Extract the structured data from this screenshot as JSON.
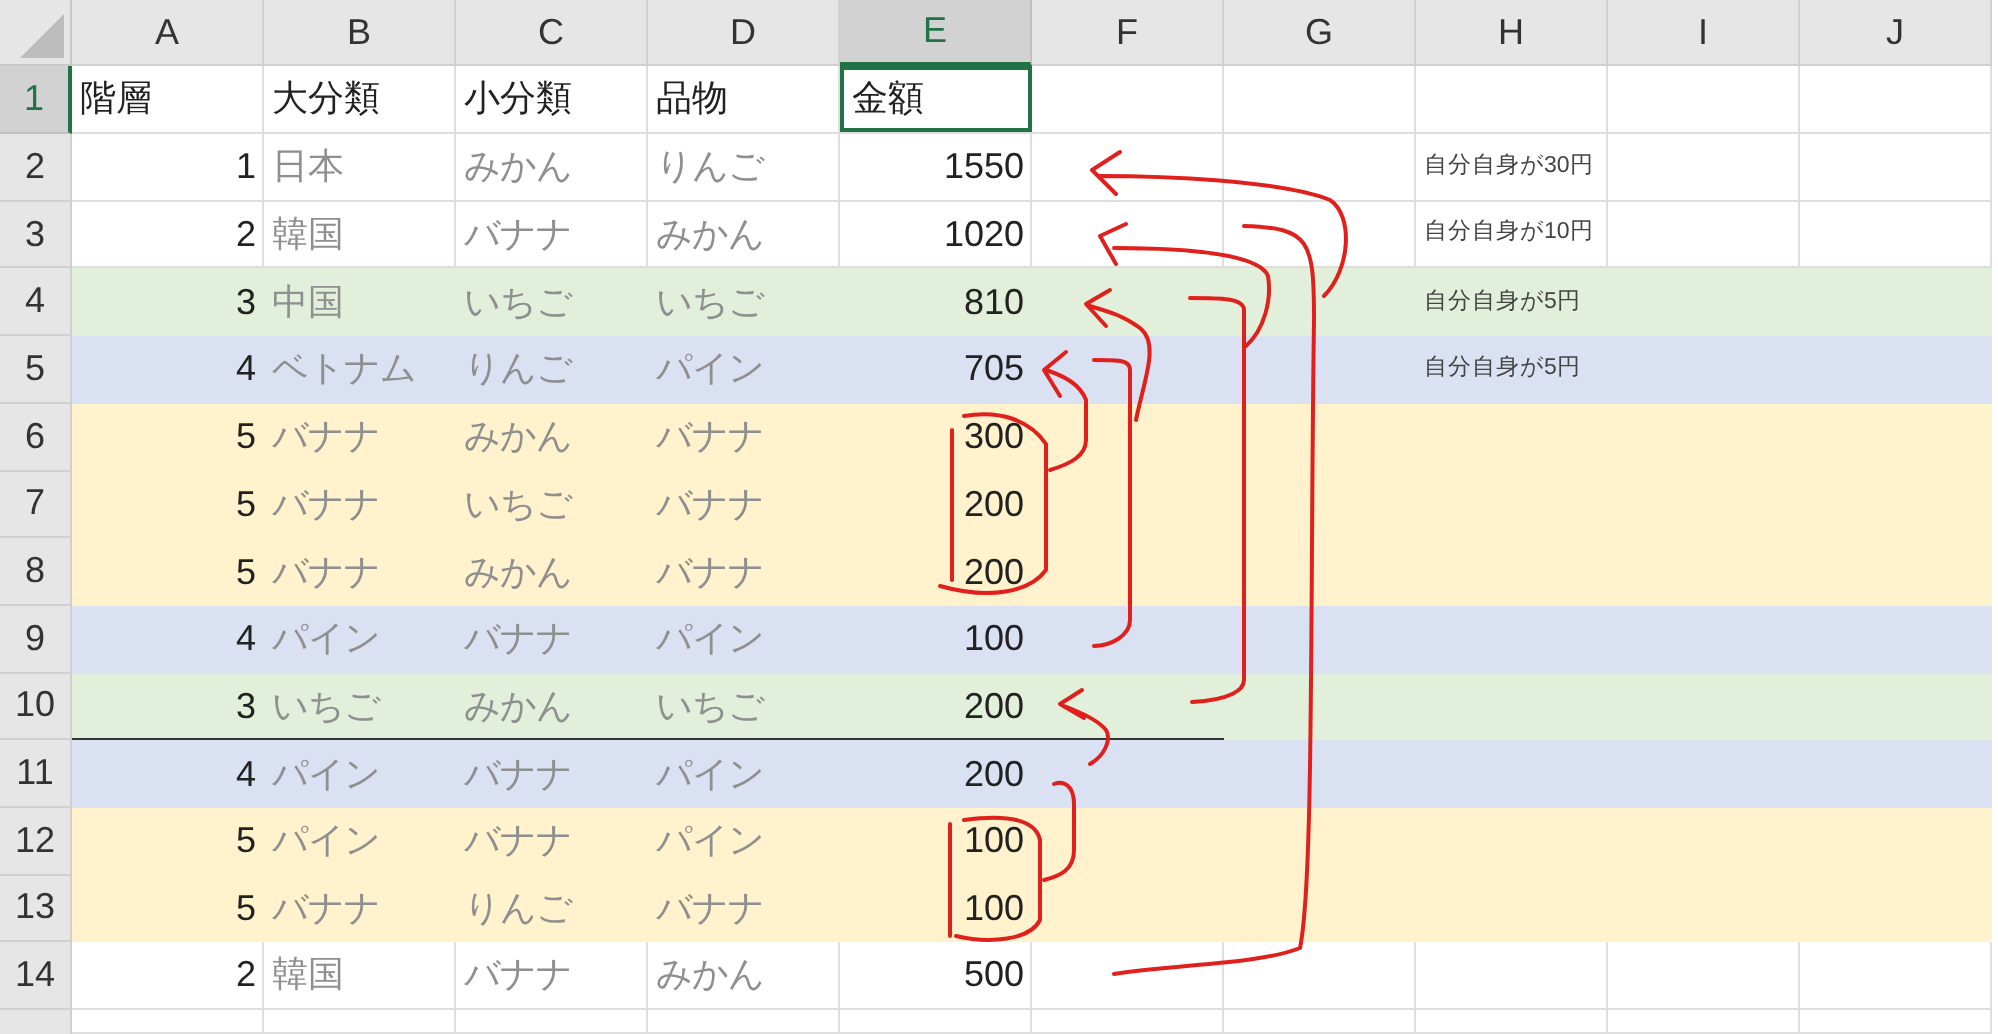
{
  "columns": [
    {
      "label": "A",
      "selected": false
    },
    {
      "label": "B",
      "selected": false
    },
    {
      "label": "C",
      "selected": false
    },
    {
      "label": "D",
      "selected": false
    },
    {
      "label": "E",
      "selected": true
    },
    {
      "label": "F",
      "selected": false
    },
    {
      "label": "G",
      "selected": false
    },
    {
      "label": "H",
      "selected": false
    },
    {
      "label": "I",
      "selected": false
    },
    {
      "label": "J",
      "selected": false
    }
  ],
  "rows": [
    {
      "number": "1",
      "selected": true,
      "kind": "header",
      "color": "#ffffff",
      "bottom_border": false,
      "cells": [
        "階層",
        "大分類",
        "小分類",
        "品物",
        "金額"
      ]
    },
    {
      "number": "2",
      "selected": false,
      "kind": "data",
      "color": "#ffffff",
      "bottom_border": false,
      "cells": [
        "1",
        "日本",
        "みかん",
        "りんご",
        "1550"
      ],
      "note": "自分自身が30円"
    },
    {
      "number": "3",
      "selected": false,
      "kind": "data",
      "color": "#ffffff",
      "bottom_border": false,
      "cells": [
        "2",
        "韓国",
        "バナナ",
        "みかん",
        "1020"
      ],
      "note": "自分自身が10円"
    },
    {
      "number": "4",
      "selected": false,
      "kind": "data",
      "color": "#e2efda",
      "bottom_border": false,
      "cells": [
        "3",
        "中国",
        "いちご",
        "いちご",
        "810"
      ],
      "note": "自分自身が5円"
    },
    {
      "number": "5",
      "selected": false,
      "kind": "data",
      "color": "#d9e1f2",
      "bottom_border": false,
      "cells": [
        "4",
        "ベトナム",
        "りんご",
        "パイン",
        "705"
      ],
      "note": "自分自身が5円"
    },
    {
      "number": "6",
      "selected": false,
      "kind": "data",
      "color": "#fff2cc",
      "bottom_border": false,
      "cells": [
        "5",
        "バナナ",
        "みかん",
        "バナナ",
        "300"
      ]
    },
    {
      "number": "7",
      "selected": false,
      "kind": "data",
      "color": "#fff2cc",
      "bottom_border": false,
      "cells": [
        "5",
        "バナナ",
        "いちご",
        "バナナ",
        "200"
      ]
    },
    {
      "number": "8",
      "selected": false,
      "kind": "data",
      "color": "#fff2cc",
      "bottom_border": false,
      "cells": [
        "5",
        "バナナ",
        "みかん",
        "バナナ",
        "200"
      ]
    },
    {
      "number": "9",
      "selected": false,
      "kind": "data",
      "color": "#d9e1f2",
      "bottom_border": false,
      "cells": [
        "4",
        "パイン",
        "バナナ",
        "パイン",
        "100"
      ]
    },
    {
      "number": "10",
      "selected": false,
      "kind": "data",
      "color": "#e2efda",
      "bottom_border": true,
      "cells": [
        "3",
        "いちご",
        "みかん",
        "いちご",
        "200"
      ]
    },
    {
      "number": "11",
      "selected": false,
      "kind": "data",
      "color": "#d9e1f2",
      "bottom_border": false,
      "cells": [
        "4",
        "パイン",
        "バナナ",
        "パイン",
        "200"
      ]
    },
    {
      "number": "12",
      "selected": false,
      "kind": "data",
      "color": "#fff2cc",
      "bottom_border": false,
      "cells": [
        "5",
        "パイン",
        "バナナ",
        "パイン",
        "100"
      ]
    },
    {
      "number": "13",
      "selected": false,
      "kind": "data",
      "color": "#fff2cc",
      "bottom_border": false,
      "cells": [
        "5",
        "バナナ",
        "りんご",
        "バナナ",
        "100"
      ]
    },
    {
      "number": "14",
      "selected": false,
      "kind": "data",
      "color": "#ffffff",
      "bottom_border": false,
      "cells": [
        "2",
        "韓国",
        "バナナ",
        "みかん",
        "500"
      ]
    }
  ]
}
